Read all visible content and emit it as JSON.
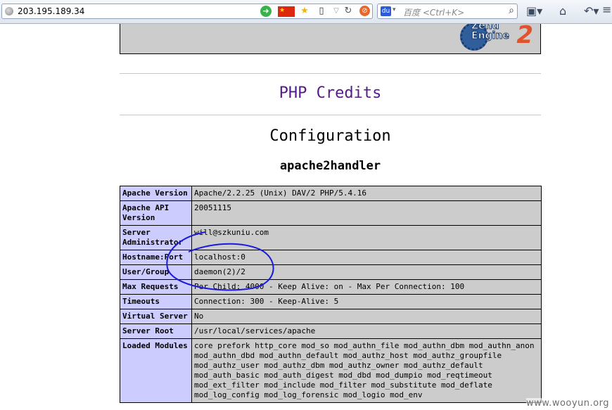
{
  "browser": {
    "url": "203.195.189.34",
    "search_placeholder": "百度 <Ctrl+K>",
    "baidu_label": "du"
  },
  "page": {
    "credits_link": "PHP Credits",
    "configuration_heading": "Configuration",
    "section_heading": "apache2handler",
    "rows": [
      {
        "label": "Apache Version",
        "value": "Apache/2.2.25 (Unix) DAV/2 PHP/5.4.16"
      },
      {
        "label": "Apache API Version",
        "value": "20051115"
      },
      {
        "label": "Server Administrator",
        "value": "will@szkuniu.com"
      },
      {
        "label": "Hostname:Port",
        "value": "localhost:0"
      },
      {
        "label": "User/Group",
        "value": "daemon(2)/2"
      },
      {
        "label": "Max Requests",
        "value": "Per Child: 4000 - Keep Alive: on - Max Per Connection: 100"
      },
      {
        "label": "Timeouts",
        "value": "Connection: 300 - Keep-Alive: 5"
      },
      {
        "label": "Virtual Server",
        "value": "No"
      },
      {
        "label": "Server Root",
        "value": "/usr/local/services/apache"
      },
      {
        "label": "Loaded Modules",
        "value": "core prefork http_core mod_so mod_authn_file mod_authn_dbm mod_authn_anon mod_authn_dbd mod_authn_default mod_authz_host mod_authz_groupfile mod_authz_user mod_authz_dbm mod_authz_owner mod_authz_default mod_auth_basic mod_auth_digest mod_dbd mod_dumpio mod_reqtimeout mod_ext_filter mod_include mod_filter mod_substitute mod_deflate mod_log_config mod_log_forensic mod_logio mod_env"
      }
    ],
    "logo_text": "Zend Engine",
    "logo_number": "2"
  },
  "watermark": "www.wooyun.org",
  "colors": {
    "label_cell": "#ccccff",
    "value_cell": "#cccccc",
    "link": "#551a8b",
    "annotation": "#1a1adc"
  }
}
